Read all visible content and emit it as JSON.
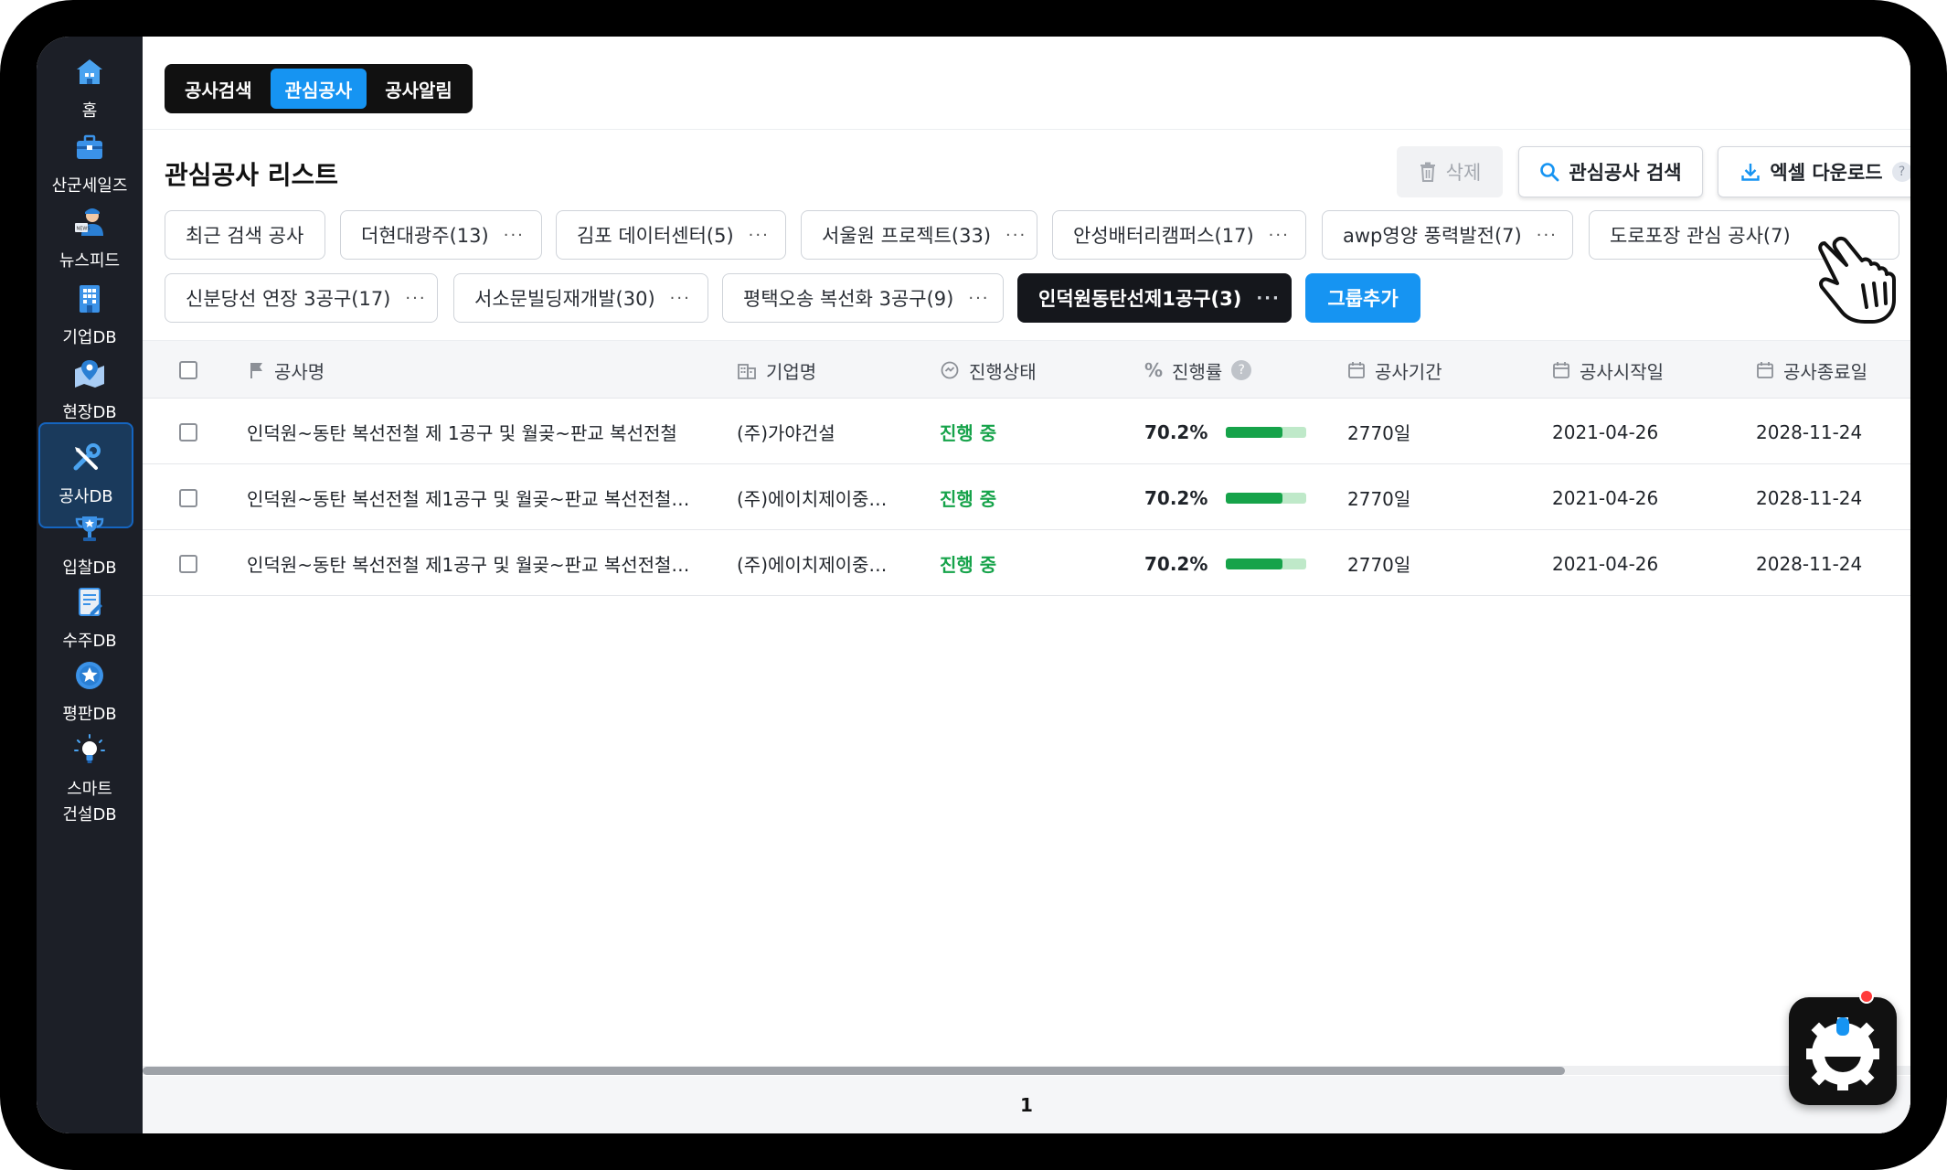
{
  "sidebar": {
    "items": [
      {
        "label": "홈",
        "icon": "home-icon"
      },
      {
        "label": "산군세일즈",
        "icon": "briefcase-icon"
      },
      {
        "label": "뉴스피드",
        "icon": "news-reporter-icon"
      },
      {
        "label": "기업DB",
        "icon": "building-icon"
      },
      {
        "label": "현장DB",
        "icon": "map-pin-icon"
      },
      {
        "label": "공사DB",
        "icon": "tools-icon",
        "active": true
      },
      {
        "label": "입찰DB",
        "icon": "trophy-icon"
      },
      {
        "label": "수주DB",
        "icon": "document-icon"
      },
      {
        "label": "평판DB",
        "icon": "star-badge-icon"
      },
      {
        "label_line1": "스마트",
        "label_line2": "건설DB",
        "icon": "lightbulb-icon"
      }
    ]
  },
  "tabs": [
    "공사검색",
    "관심공사",
    "공사알림"
  ],
  "active_tab": "관심공사",
  "page_title": "관심공사 리스트",
  "actions": {
    "delete": "삭제",
    "search": "관심공사 검색",
    "excel": "엑셀 다운로드",
    "help": "?"
  },
  "groups_row1": [
    {
      "label": "최근 검색 공사",
      "menu": false
    },
    {
      "label": "더현대광주(13)",
      "menu": true
    },
    {
      "label": "김포 데이터센터(5)",
      "menu": true
    },
    {
      "label": "서울원 프로젝트(33)",
      "menu": true
    },
    {
      "label": "안성배터리캠퍼스(17)",
      "menu": true
    },
    {
      "label": "awp영양 풍력발전(7)",
      "menu": true
    },
    {
      "label": "도로포장 관심 공사(7)",
      "menu": false
    }
  ],
  "groups_row2": [
    {
      "label": "신분당선 연장 3공구(17)",
      "menu": true
    },
    {
      "label": "서소문빌딩재개발(30)",
      "menu": true
    },
    {
      "label": "평택오송 복선화 3공구(9)",
      "menu": true
    },
    {
      "label": "인덕원동탄선제1공구(3)",
      "menu": true,
      "selected": true
    }
  ],
  "add_group": "그룹추가",
  "menu_dots": "···",
  "table": {
    "columns": {
      "name": "공사명",
      "company": "기업명",
      "status": "진행상태",
      "rate": "진행률",
      "period": "공사기간",
      "start": "공사시작일",
      "end": "공사종료일"
    },
    "rows": [
      {
        "name": "인덕원~동탄 복선전철 제 1공구 및 월곶~판교 복선전철",
        "company": "(주)가야건설",
        "status": "진행 중",
        "rate": "70.2%",
        "rate_value": 0.702,
        "period": "2770일",
        "start": "2021-04-26",
        "end": "2028-11-24"
      },
      {
        "name": "인덕원~동탄 복선전철 제1공구 및 월곶~판교 복선전철…",
        "company": "(주)에이치제이중…",
        "status": "진행 중",
        "rate": "70.2%",
        "rate_value": 0.702,
        "period": "2770일",
        "start": "2021-04-26",
        "end": "2028-11-24"
      },
      {
        "name": "인덕원~동탄 복선전철 제1공구 및 월곶~판교 복선전철…",
        "company": "(주)에이치제이중…",
        "status": "진행 중",
        "rate": "70.2%",
        "rate_value": 0.702,
        "period": "2770일",
        "start": "2021-04-26",
        "end": "2028-11-24"
      }
    ]
  },
  "pagination": {
    "current": "1"
  },
  "colors": {
    "accent": "#1694f2",
    "status_green": "#16a34a",
    "sidebar_bg": "#1c1f27"
  }
}
